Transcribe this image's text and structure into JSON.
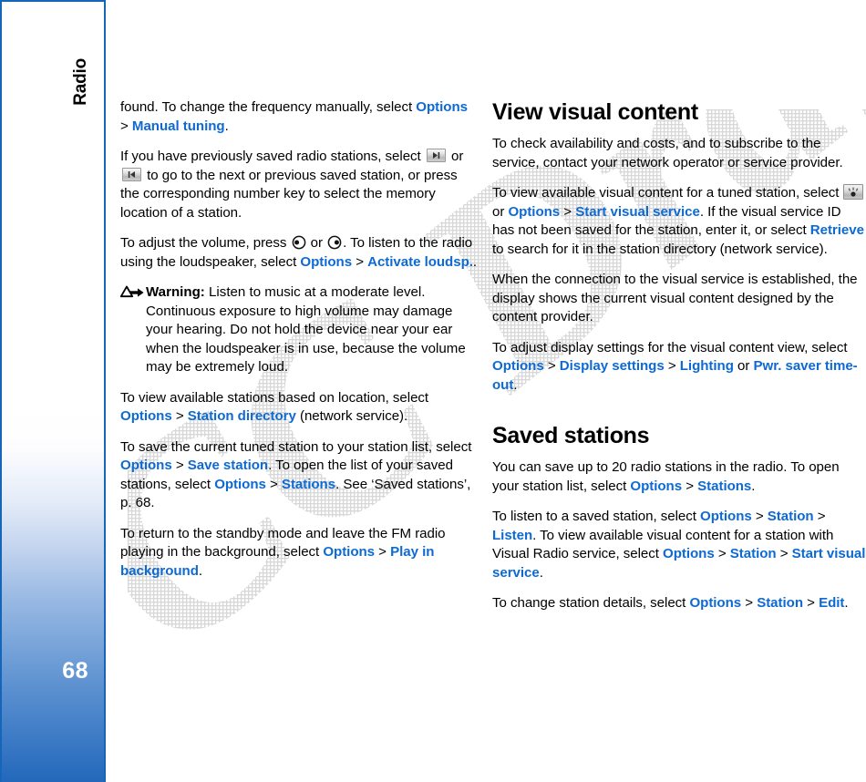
{
  "sidebar": {
    "chapter_label": "Radio",
    "page_number": "68",
    "gradient_top": "#ffffff",
    "gradient_bottom": "#2368bb",
    "border_color": "#1565b8"
  },
  "watermark": {
    "text": "FCC Draft",
    "color": "#d8d8d8"
  },
  "colors": {
    "link": "#0e6ad2",
    "body_text": "#000000"
  },
  "left_column": {
    "paragraphs": [
      {
        "id": "manual-tuning",
        "runs": [
          {
            "t": "found. To change the frequency manually, select "
          },
          {
            "t": "Options",
            "k": true
          },
          {
            "t": " > "
          },
          {
            "t": "Manual tuning",
            "k": true
          },
          {
            "t": "."
          }
        ]
      },
      {
        "id": "saved-stations-nav",
        "runs": [
          {
            "t": "If you have previously saved radio stations, select "
          },
          {
            "icon": "next-station-key"
          },
          {
            "t": " or "
          },
          {
            "icon": "previous-station-key"
          },
          {
            "t": " to go to the next or previous saved station, or press the corresponding number key to select the memory location of a station."
          }
        ]
      },
      {
        "id": "adjust-volume",
        "runs": [
          {
            "t": "To adjust the volume, press "
          },
          {
            "icon": "scroll-left-key"
          },
          {
            "t": " or "
          },
          {
            "icon": "scroll-right-key"
          },
          {
            "t": ". To listen to the radio using the loudspeaker, select "
          },
          {
            "t": "Options",
            "k": true
          },
          {
            "t": " > "
          },
          {
            "t": "Activate loudsp.",
            "k": true
          },
          {
            "t": "."
          }
        ]
      }
    ],
    "warning": {
      "icon": "warning-triangle-icon",
      "label": "Warning:",
      "text": " Listen to music at a moderate level. Continuous exposure to high volume may damage your hearing. Do not hold the device near your ear when the loudspeaker is in use, because the volume may be extremely loud."
    },
    "paragraphs_after_warning": [
      {
        "id": "station-directory",
        "runs": [
          {
            "t": "To view available stations based on location, select "
          },
          {
            "t": "Options",
            "k": true
          },
          {
            "t": " > "
          },
          {
            "t": "Station directory",
            "k": true
          },
          {
            "t": " (network service)."
          }
        ]
      },
      {
        "id": "save-station",
        "runs": [
          {
            "t": "To save the current tuned station to your station list, select "
          },
          {
            "t": "Options",
            "k": true
          },
          {
            "t": " > "
          },
          {
            "t": "Save station",
            "k": true
          },
          {
            "t": ". To open the list of your saved stations, select "
          },
          {
            "t": "Options",
            "k": true
          },
          {
            "t": " > "
          },
          {
            "t": "Stations",
            "k": true
          },
          {
            "t": ". See ‘Saved stations’, p. 68."
          }
        ]
      },
      {
        "id": "play-in-background",
        "runs": [
          {
            "t": "To return to the standby mode and leave the FM radio playing in the background, select "
          },
          {
            "t": "Options",
            "k": true
          },
          {
            "t": " > "
          },
          {
            "t": "Play in background",
            "k": true
          },
          {
            "t": "."
          }
        ]
      }
    ]
  },
  "right_column": {
    "heading_1": "View visual content",
    "paragraphs_1": [
      {
        "id": "check-availability",
        "runs": [
          {
            "t": "To check availability and costs, and to subscribe to the service, contact your network operator or service provider."
          }
        ]
      },
      {
        "id": "start-visual-service",
        "runs": [
          {
            "t": "To view available visual content for a tuned station, select "
          },
          {
            "icon": "visual-service-key"
          },
          {
            "t": " or "
          },
          {
            "t": "Options",
            "k": true
          },
          {
            "t": " > "
          },
          {
            "t": "Start visual service",
            "k": true
          },
          {
            "t": ". If the visual service ID has not been saved for the station, enter it, or select "
          },
          {
            "t": "Retrieve",
            "k": true
          },
          {
            "t": " to search for it in the station directory (network service)."
          }
        ]
      },
      {
        "id": "connection-established",
        "runs": [
          {
            "t": "When the connection to the visual service is established, the display shows the current visual content designed by the content provider."
          }
        ]
      },
      {
        "id": "display-settings",
        "runs": [
          {
            "t": "To adjust display settings for the visual content view, select "
          },
          {
            "t": "Options",
            "k": true
          },
          {
            "t": " > "
          },
          {
            "t": "Display settings",
            "k": true
          },
          {
            "t": " > "
          },
          {
            "t": "Lighting",
            "k": true
          },
          {
            "t": " or "
          },
          {
            "t": "Pwr. saver time-out",
            "k": true
          },
          {
            "t": "."
          }
        ]
      }
    ],
    "heading_2": "Saved stations",
    "paragraphs_2": [
      {
        "id": "save-up-to-20",
        "runs": [
          {
            "t": "You can save up to 20 radio stations in the radio. To open your station list, select "
          },
          {
            "t": "Options",
            "k": true
          },
          {
            "t": " > "
          },
          {
            "t": "Stations",
            "k": true
          },
          {
            "t": "."
          }
        ]
      },
      {
        "id": "listen-saved-station",
        "runs": [
          {
            "t": "To listen to a saved station, select "
          },
          {
            "t": "Options",
            "k": true
          },
          {
            "t": " > "
          },
          {
            "t": "Station",
            "k": true
          },
          {
            "t": " > "
          },
          {
            "t": "Listen",
            "k": true
          },
          {
            "t": ". To view available visual content for a station with Visual Radio service, select "
          },
          {
            "t": "Options",
            "k": true
          },
          {
            "t": " > "
          },
          {
            "t": "Station",
            "k": true
          },
          {
            "t": " > "
          },
          {
            "t": "Start visual service",
            "k": true
          },
          {
            "t": "."
          }
        ]
      },
      {
        "id": "edit-station-details",
        "runs": [
          {
            "t": "To change station details, select "
          },
          {
            "t": "Options",
            "k": true
          },
          {
            "t": " > "
          },
          {
            "t": "Station",
            "k": true
          },
          {
            "t": " > "
          },
          {
            "t": "Edit",
            "k": true
          },
          {
            "t": "."
          }
        ]
      }
    ]
  }
}
